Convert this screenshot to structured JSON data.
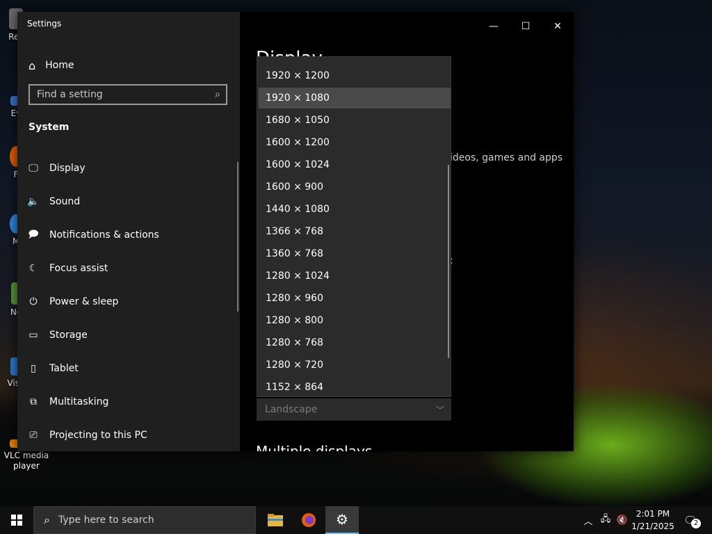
{
  "desktop": {
    "icons": [
      {
        "label": "Rec",
        "color": "#8a8a8a"
      },
      {
        "label": "Ev",
        "color": "#3a7bd5"
      },
      {
        "label": "F",
        "color": "#e66000"
      },
      {
        "label": "M",
        "color": "#2f8de4"
      },
      {
        "label": "No",
        "color": "#5b9b3a"
      },
      {
        "label": "Visu",
        "color": "#2a7fd6"
      },
      {
        "label": "VLC media player",
        "color": "#f08a00"
      }
    ]
  },
  "window": {
    "title": "Settings",
    "controls": {
      "minimize": "—",
      "maximize": "☐",
      "close": "✕"
    }
  },
  "nav": {
    "home_label": "Home",
    "search_placeholder": "Find a setting",
    "section_title": "System",
    "items": [
      {
        "label": "Display",
        "icon": "🖵"
      },
      {
        "label": "Sound",
        "icon": "🔈"
      },
      {
        "label": "Notifications & actions",
        "icon": "🗩"
      },
      {
        "label": "Focus assist",
        "icon": "☾"
      },
      {
        "label": "Power & sleep",
        "icon": "⏻"
      },
      {
        "label": "Storage",
        "icon": "▭"
      },
      {
        "label": "Tablet",
        "icon": "▯"
      },
      {
        "label": "Multitasking",
        "icon": "⧉"
      },
      {
        "label": "Projecting to this PC",
        "icon": "⎚"
      }
    ]
  },
  "content": {
    "heading": "Display",
    "text_fragment": "ideos, games and apps",
    "colon": ":",
    "multiple_displays": "Multiple displays",
    "orientation_value": "Landscape"
  },
  "dropdown": {
    "selected_index": 1,
    "options": [
      "1920 × 1200",
      "1920 × 1080",
      "1680 × 1050",
      "1600 × 1200",
      "1600 × 1024",
      "1600 × 900",
      "1440 × 1080",
      "1366 × 768",
      "1360 × 768",
      "1280 × 1024",
      "1280 × 960",
      "1280 × 800",
      "1280 × 768",
      "1280 × 720",
      "1152 × 864"
    ]
  },
  "taskbar": {
    "search_placeholder": "Type here to search",
    "time": "2:01 PM",
    "date": "1/21/2025",
    "notification_count": "2"
  },
  "colors": {
    "accent": "#76b9ed",
    "nav_bg": "#1f1f1f",
    "dropdown_bg": "#2b2b2b",
    "selected_bg": "#4a4a4a"
  }
}
